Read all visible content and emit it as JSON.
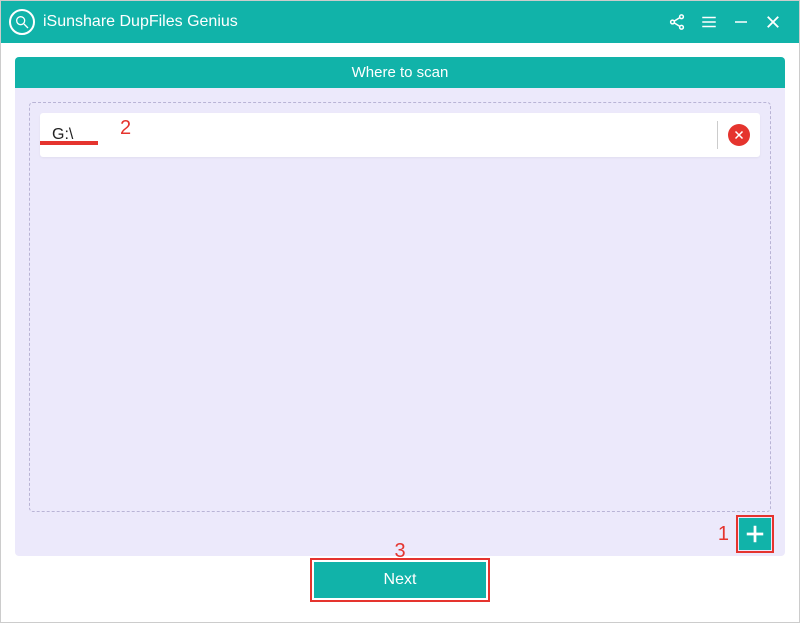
{
  "titlebar": {
    "app_title": "iSunshare DupFiles Genius"
  },
  "panel": {
    "header": "Where to scan",
    "paths": [
      {
        "path": "G:\\"
      }
    ]
  },
  "footer": {
    "next_label": "Next"
  },
  "annotations": {
    "callout1": "1",
    "callout2": "2",
    "callout3": "3"
  }
}
